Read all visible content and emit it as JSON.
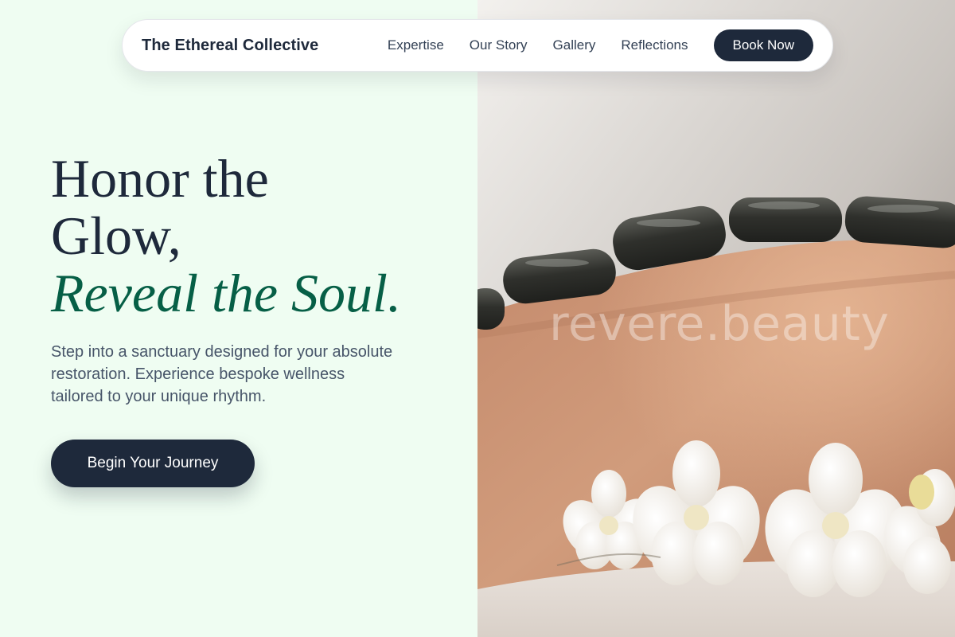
{
  "brand": {
    "name": "The Ethereal Collective"
  },
  "nav": {
    "links": [
      "Expertise",
      "Our Story",
      "Gallery",
      "Reflections"
    ],
    "cta_label": "Book Now"
  },
  "hero": {
    "heading_line1": "Honor the",
    "heading_line2": "Glow,",
    "heading_accent": "Reveal the Soul.",
    "subtext": "Step into a sanctuary designed for your absolute restoration. Experience bespoke wellness tailored to your unique rhythm.",
    "cta_label": "Begin Your Journey"
  },
  "image": {
    "watermark": "revere.beauty",
    "subject": "hot stone massage with white orchids"
  },
  "colors": {
    "background": "#effdf2",
    "primary_dark": "#1e293b",
    "accent_green": "#065f46",
    "body_text": "#475569"
  }
}
